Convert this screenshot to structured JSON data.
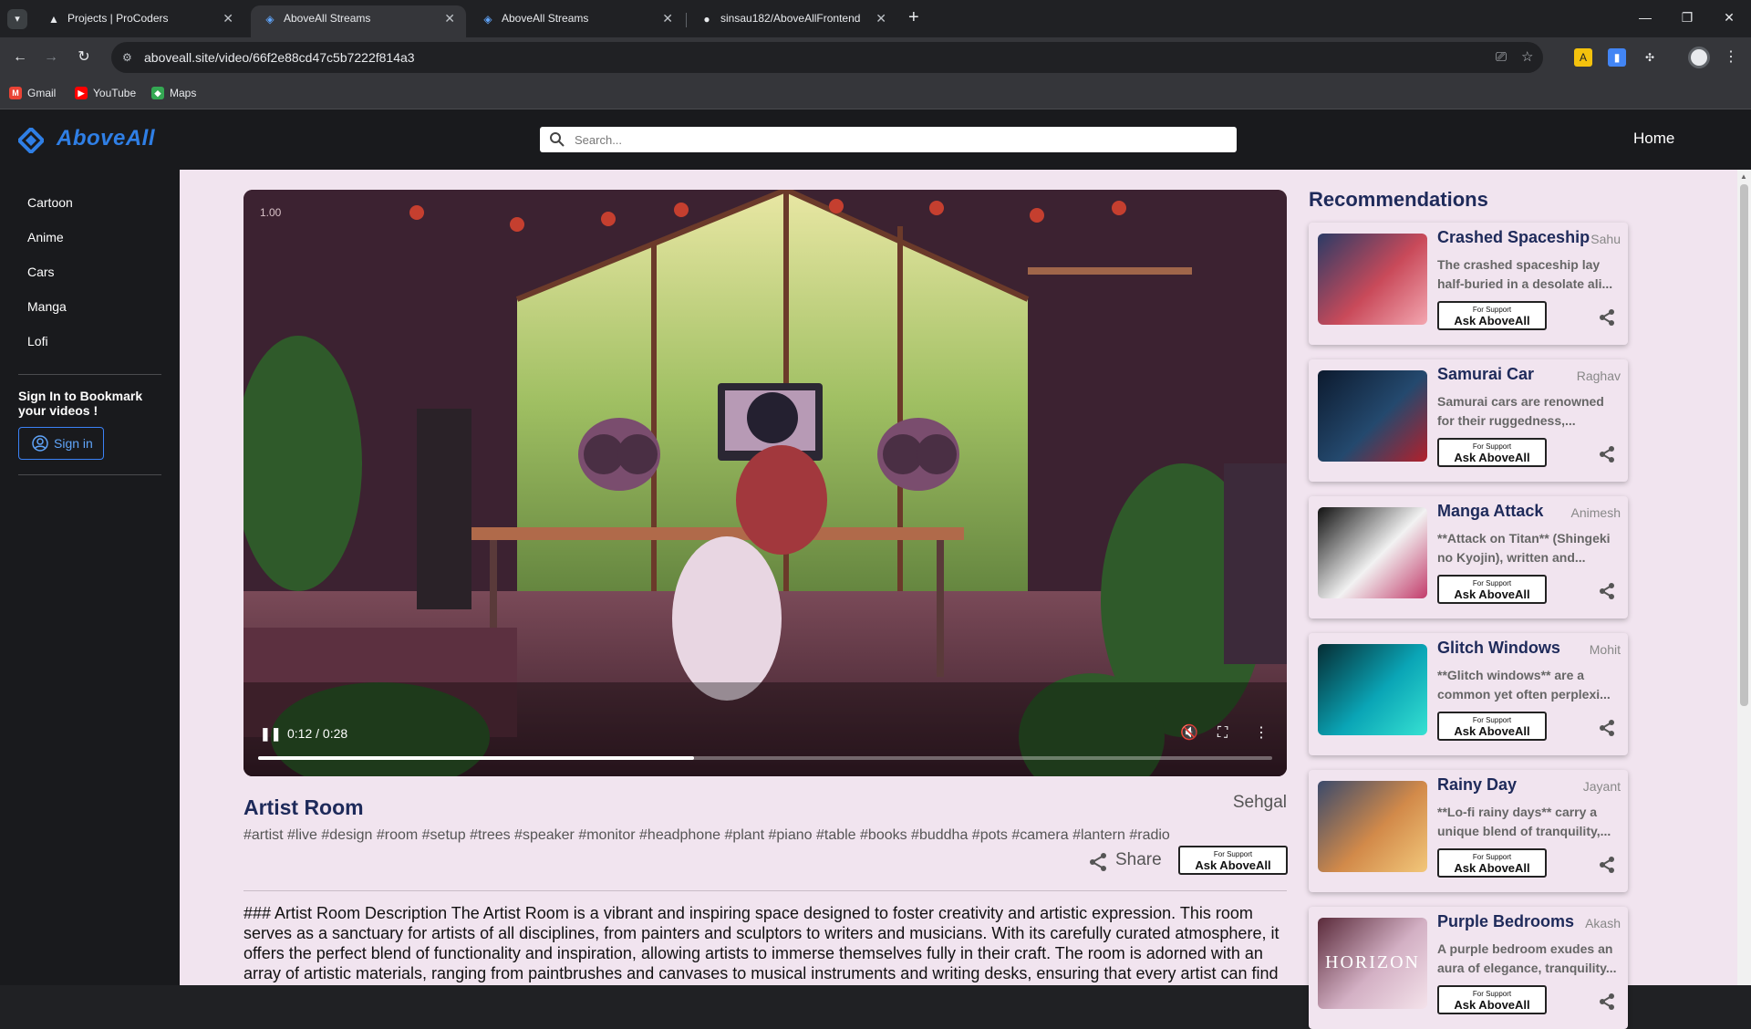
{
  "browser": {
    "tabs": [
      {
        "title": "Projects | ProCoders",
        "active": false,
        "icon": "procoders-icon"
      },
      {
        "title": "AboveAll Streams",
        "active": true,
        "icon": "aboveall-icon"
      },
      {
        "title": "AboveAll Streams",
        "active": false,
        "icon": "aboveall-icon"
      },
      {
        "title": "sinsau182/AboveAllFrontend",
        "active": false,
        "icon": "github-icon"
      }
    ],
    "url": "aboveall.site/video/66f2e88cd47c5b7222f814a3",
    "bookmarks": [
      {
        "label": "Gmail",
        "icon": "gmail-icon"
      },
      {
        "label": "YouTube",
        "icon": "youtube-icon"
      },
      {
        "label": "Maps",
        "icon": "maps-icon"
      }
    ]
  },
  "header": {
    "logo_text": "AboveAll",
    "search_placeholder": "Search...",
    "home_label": "Home"
  },
  "sidebar": {
    "items": [
      "Cartoon",
      "Anime",
      "Cars",
      "Manga",
      "Lofi"
    ],
    "signin_prompt": "Sign In to Bookmark your videos !",
    "signin_label": "Sign in"
  },
  "player": {
    "speed": "1.00",
    "time": "0:12 / 0:28",
    "progress_fraction": 0.43,
    "muted": true
  },
  "video": {
    "title": "Artist Room",
    "author": "Sehgal",
    "tags": "#artist #live #design #room #setup #trees #speaker #monitor #headphone #plant #piano #table #books #buddha #pots #camera #lantern #radio",
    "share_label": "Share",
    "support_small": "For Support",
    "support_big": "Ask AboveAll",
    "description": "### Artist Room Description The Artist Room is a vibrant and inspiring space designed to foster creativity and artistic expression. This room serves as a sanctuary for artists of all disciplines, from painters and sculptors to writers and musicians. With its carefully curated atmosphere, it offers the perfect blend of functionality and inspiration, allowing artists to immerse themselves fully in their craft. The room is adorned with an array of artistic materials, ranging from paintbrushes and canvases to musical instruments and writing desks, ensuring that every artist can find"
  },
  "recommendations": {
    "heading": "Recommendations",
    "items": [
      {
        "title": "Crashed Spaceship",
        "author": "Sahu",
        "desc": "The crashed spaceship lay half-buried in a desolate ali...",
        "colors": [
          "#2b3b66",
          "#c94a5a",
          "#f3a6b0"
        ]
      },
      {
        "title": "Samurai Car",
        "author": "Raghav",
        "desc": "Samurai cars are renowned for their ruggedness,...",
        "colors": [
          "#0c1a2e",
          "#24496e",
          "#b3202b"
        ]
      },
      {
        "title": "Manga Attack",
        "author": "Animesh",
        "desc": "**Attack on Titan** (Shingeki no Kyojin), written and...",
        "colors": [
          "#111111",
          "#f2f2f2",
          "#c23b6a"
        ]
      },
      {
        "title": "Glitch Windows",
        "author": "Mohit",
        "desc": "**Glitch windows** are a common yet often perplexi...",
        "colors": [
          "#062c33",
          "#0aa5b6",
          "#36e1d2"
        ]
      },
      {
        "title": "Rainy Day",
        "author": "Jayant",
        "desc": "**Lo-fi rainy days** carry a unique blend of tranquility,...",
        "colors": [
          "#3b4a6b",
          "#d28a4a",
          "#f2c77a"
        ]
      },
      {
        "title": "Purple Bedrooms",
        "author": "Akash",
        "desc": "A purple bedroom exudes an aura of elegance, tranquility...",
        "colors": [
          "#5a2a3a",
          "#d3b0c4",
          "#f4e2ea"
        ],
        "overlay": "HORIZON"
      }
    ]
  }
}
